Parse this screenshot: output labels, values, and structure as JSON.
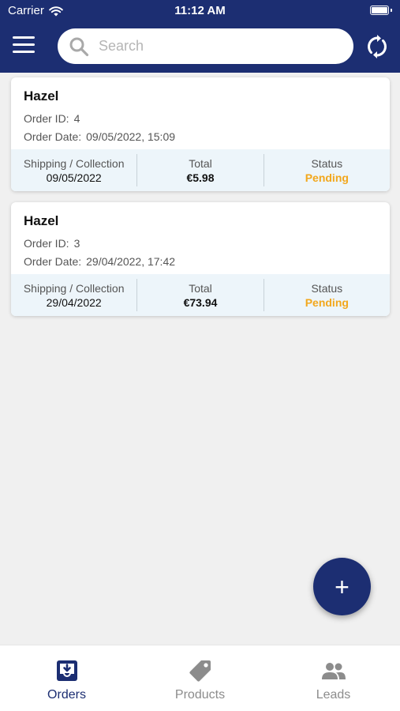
{
  "status_bar": {
    "carrier": "Carrier",
    "time": "11:12 AM"
  },
  "header": {
    "search_placeholder": "Search"
  },
  "orders": [
    {
      "customer": "Hazel",
      "order_id_label": "Order ID:",
      "order_id": "4",
      "order_date_label": "Order Date:",
      "order_date": "09/05/2022, 15:09",
      "shipping_label": "Shipping / Collection",
      "shipping_date": "09/05/2022",
      "total_label": "Total",
      "total": "€5.98",
      "status_label": "Status",
      "status": "Pending"
    },
    {
      "customer": "Hazel",
      "order_id_label": "Order ID:",
      "order_id": "3",
      "order_date_label": "Order Date:",
      "order_date": "29/04/2022, 17:42",
      "shipping_label": "Shipping / Collection",
      "shipping_date": "29/04/2022",
      "total_label": "Total",
      "total": "€73.94",
      "status_label": "Status",
      "status": "Pending"
    }
  ],
  "fab": {
    "icon": "+"
  },
  "tabs": [
    {
      "label": "Orders",
      "icon": "inbox-icon",
      "active": true
    },
    {
      "label": "Products",
      "icon": "tag-icon",
      "active": false
    },
    {
      "label": "Leads",
      "icon": "people-icon",
      "active": false
    }
  ],
  "colors": {
    "primary": "#1c2e72",
    "status_pending": "#f2a71c",
    "card_footer": "#edf5fa",
    "background": "#f0f0f0"
  }
}
